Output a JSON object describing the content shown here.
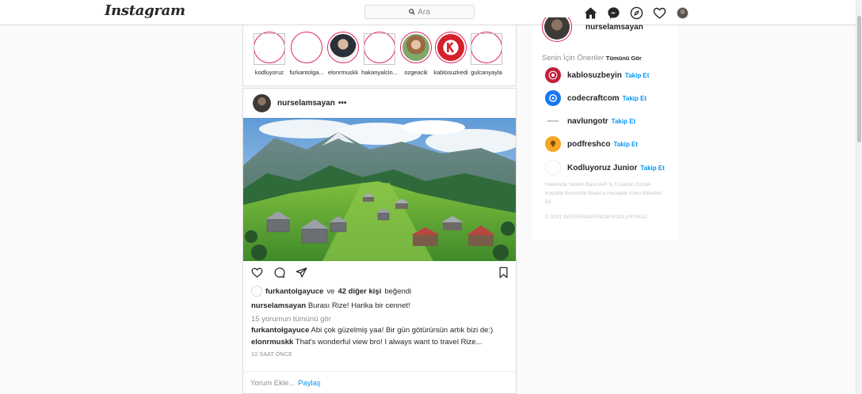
{
  "header": {
    "logo": "Instagram",
    "search_placeholder": "Ara",
    "icons": [
      "home-icon",
      "messenger-icon",
      "explore-icon",
      "heart-icon",
      "profile-avatar"
    ]
  },
  "stories": [
    {
      "name": "kodluyoruz"
    },
    {
      "name": "furkantolga..."
    },
    {
      "name": "elonrmuskk"
    },
    {
      "name": "hakanyalcin..."
    },
    {
      "name": "ozgeacik"
    },
    {
      "name": "kablosuzkedi"
    },
    {
      "name": "gulcanyayla"
    }
  ],
  "post": {
    "username": "nurselamsayan",
    "more": "•••",
    "liked_by_user": "furkantolgayuce",
    "liked_connector": "ve",
    "liked_others": "42 diğer kişi",
    "liked_suffix": "beğendi",
    "caption_user": "nurselamsayan",
    "caption_text": "Burası Rize! Harika bir cennet!",
    "view_comments": "15 yorumun tümünü gör",
    "comments": [
      {
        "user": "furkantolgayuce",
        "text": "Abi çok güzelmiş yaa! Bir gün götürürsün artık bizi de:)"
      },
      {
        "user": "elonrmuskk",
        "text": "That's wonderful view bro! I always want to travel Rize..."
      }
    ],
    "time": "10 SAAT ÖNCE",
    "comment_placeholder": "Yorum Ekle...",
    "share_label": "Paylaş"
  },
  "sidebar": {
    "username": "nurselamsayan",
    "suggestions_title": "Senin İçin Öneriler",
    "see_all": "Tümünü Gör",
    "suggestions": [
      {
        "name": "kablosuzbeyin",
        "follow": "Takip Et"
      },
      {
        "name": "codecraftcom",
        "follow": "Takip Et"
      },
      {
        "name": "navlungotr",
        "follow": "Takip Et"
      },
      {
        "name": "podfreshco",
        "follow": "Takip Et"
      },
      {
        "name": "Kodluyoruz Junior",
        "follow": "Takip Et"
      }
    ],
    "footer_links": "Hakkında Yardım BasınAPI İş Fırsatları Gizlilik Koşullar Konumlar Başlıca Hesaplar Konu Etiketleri Dil",
    "copyright": "© 2021 INSTAGRAM FROM KODLUYORUZ"
  }
}
